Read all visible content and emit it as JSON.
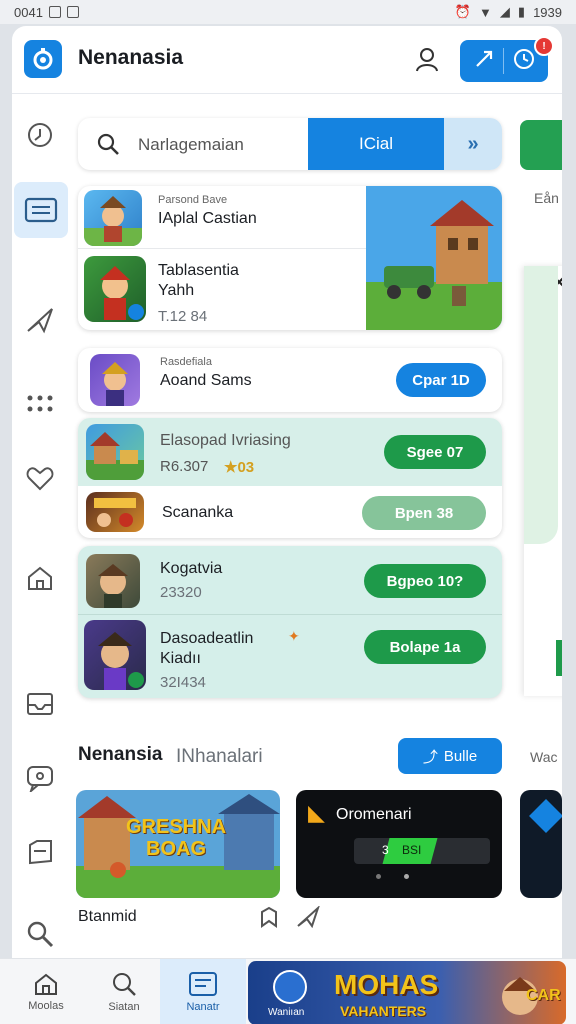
{
  "status_bar": {
    "time": "0041",
    "clock": "1939"
  },
  "header": {
    "app_title": "Nenanasia",
    "notification_count": "!",
    "icons": [
      "app-logo-icon",
      "user-icon",
      "share-icon",
      "clock-icon"
    ]
  },
  "rail": {
    "icons": [
      "pin-icon",
      "list-icon",
      "send-icon",
      "grid-icon",
      "heart-icon",
      "home-icon",
      "chat-icon",
      "folder-icon",
      "inbox-icon",
      "search-icon"
    ]
  },
  "search": {
    "placeholder": "Narlagemaian",
    "button_label": "ICial",
    "more_label": "»"
  },
  "peek": {
    "right_text": "Eån"
  },
  "featured": {
    "top": {
      "small": "Parsond Bave",
      "name": "IAplal Castian"
    },
    "bottom": {
      "name_line1": "Tablasentia",
      "name_line2": "Yahh",
      "meta": "T.12 84"
    }
  },
  "rows": [
    {
      "small": "Rasdefiala",
      "name": "Aoand Sams",
      "button": "Cpar 1D",
      "color": "#1583e0"
    },
    {
      "name": "Elasopad Ivriasing",
      "meta": "R6.307",
      "rating": "★03",
      "button": "Sgee 07",
      "color": "#1e9a4a"
    },
    {
      "name": "Scananka",
      "button": "Bpen 38",
      "color": "#86c49a"
    },
    {
      "name": "Kogatvia",
      "meta": "23320",
      "button": "Bgpeo 10?",
      "color": "#1e9a4a"
    },
    {
      "name_line1": "Dasoadeatlin",
      "name_line2": "Kiadıı",
      "meta": "32І434",
      "button": "Bolape 1a",
      "color": "#1e9a4a"
    }
  ],
  "section": {
    "title": "Nenansia",
    "subtitle": "INhanalari",
    "button_label": "Bulle",
    "peek_text": "Wac"
  },
  "tiles": {
    "banner1_text_line1": "GRESHNA",
    "banner1_text_line2": "BOAG",
    "card2_title": "Oromenari",
    "card2_left": "3",
    "card2_progress": "BSI",
    "caption": "Btanmid"
  },
  "bottom_nav": {
    "items": [
      {
        "label": "Moolas"
      },
      {
        "label": "Siatan"
      },
      {
        "label": "Nanatr"
      }
    ],
    "banner_label": "Waniıan",
    "banner_title": "MOHAS",
    "banner_sub": "VAHANTERS",
    "banner_peek": "CAR"
  }
}
